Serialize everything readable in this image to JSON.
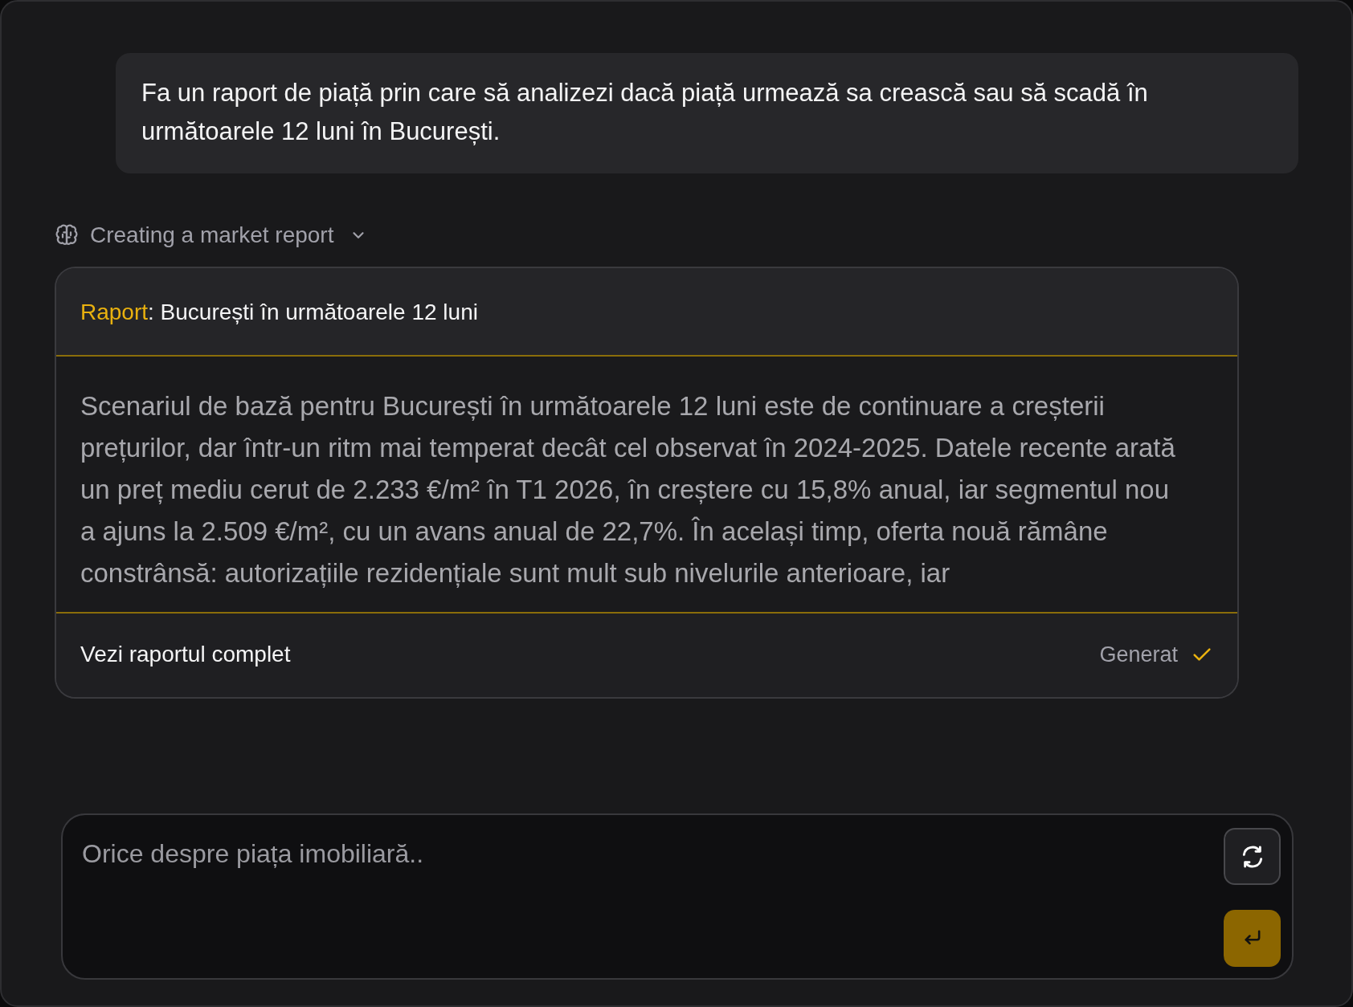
{
  "user_message": {
    "text": "Fa un raport de piață prin care să analizezi dacă piață urmează sa crească sau să scadă în următoarele 12 luni în București."
  },
  "thinking": {
    "label": "Creating a market report",
    "expanded": false
  },
  "report_card": {
    "title_prefix": "Raport",
    "title": ": București în următoarele 12 luni",
    "body": "Scenariul de bază pentru București în următoarele 12 luni este de continuare a creșterii prețurilor, dar într-un ritm mai temperat decât cel observat în 2024-2025. Datele recente arată un preț mediu cerut de 2.233 €/m² în T1 2026, în creștere cu 15,8% anual, iar segmentul nou a ajuns la 2.509 €/m², cu un avans anual de 22,7%. În același timp, oferta nouă rămâne constrânsă: autorizațiile rezidențiale sunt mult sub nivelurile anterioare, iar",
    "link": "Vezi raportul complet",
    "status": "Generat",
    "done": true
  },
  "composer": {
    "placeholder": "Orice despre piața imobiliară.."
  }
}
